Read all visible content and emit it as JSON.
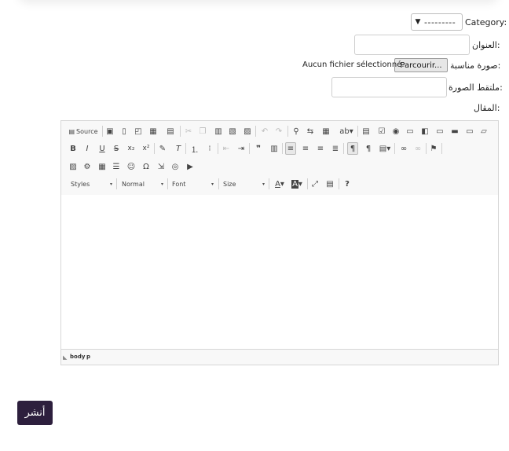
{
  "form": {
    "category_label": "Category:",
    "category_value": "---------",
    "title_label": "العنوان:",
    "image_label": "صورة مناسبة:",
    "file_button": "Parcourir...",
    "file_status": "Aucun fichier sélectionné.",
    "image_caption_label": "ملتقط الصورة:",
    "article_label": "المقال:",
    "publish_button": "أنشر"
  },
  "editor": {
    "source_label": "Source",
    "styles": "Styles",
    "format": "Normal",
    "font": "Font",
    "size": "Size",
    "help": "?",
    "status_body": "body",
    "status_p": "p"
  },
  "icons": {
    "dropdown": "▼",
    "combo": "▾"
  }
}
